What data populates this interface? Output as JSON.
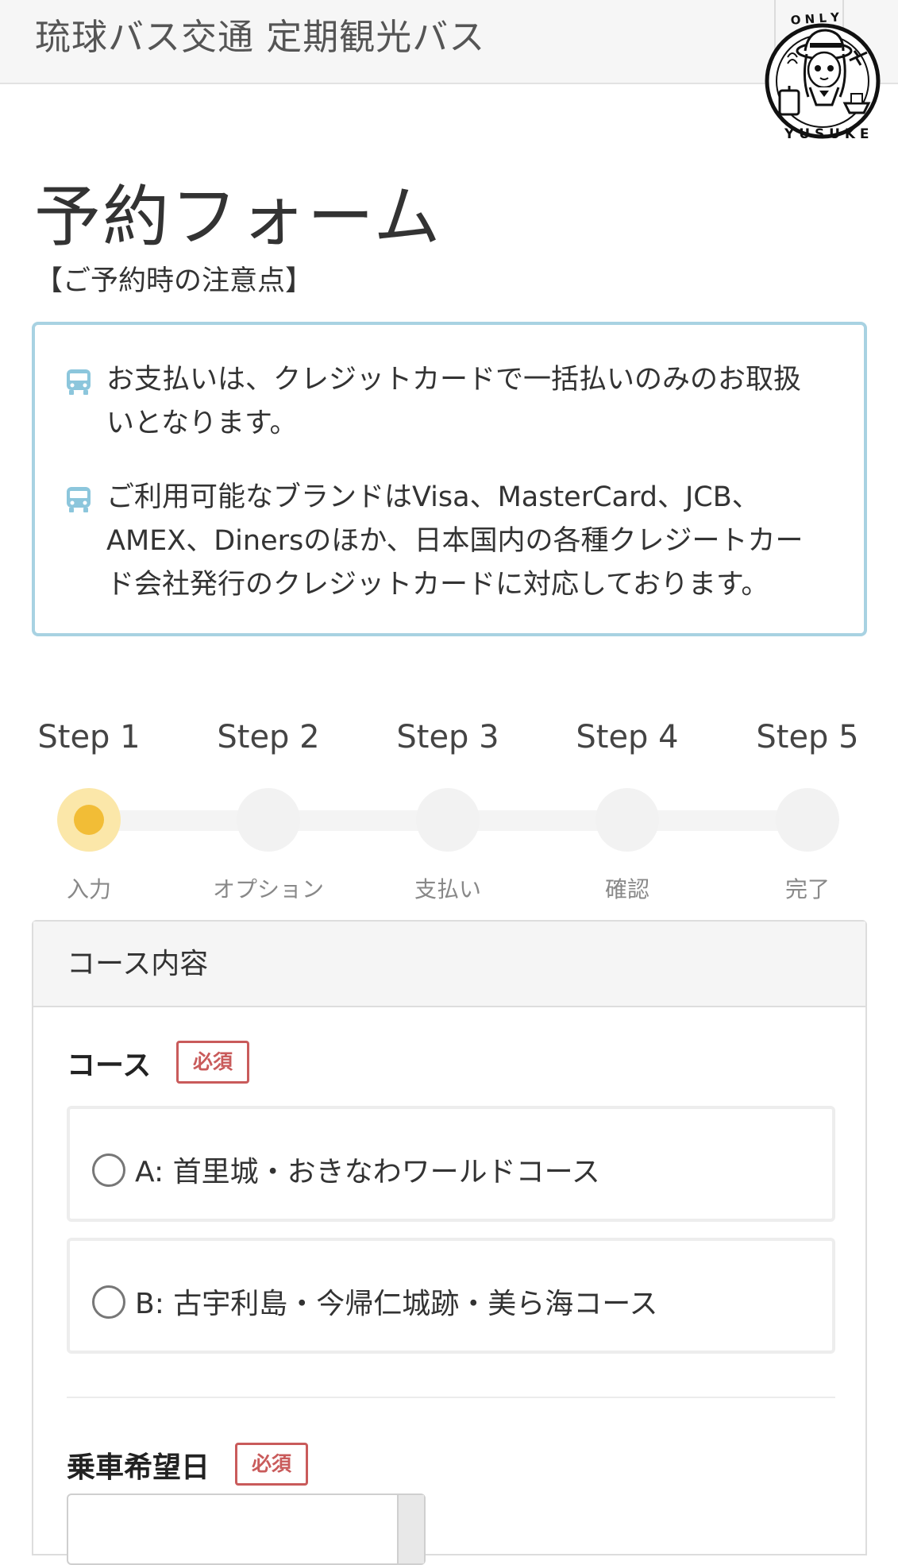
{
  "header": {
    "title": "琉球バス交通 定期観光バス",
    "stamp_text_top": "ONLY",
    "stamp_text_bottom": "YUSUKE"
  },
  "page_title": "予約フォーム",
  "notice": {
    "heading": "【ご予約時の注意点】",
    "items": [
      {
        "text": "お支払いは、クレジットカードで一括払いのみのお取扱いとなります。"
      },
      {
        "text": "ご利用可能なブランドはVisa、MasterCard、JCB、AMEX、Dinersのほか、日本国内の各種クレジートカード会社発行のクレジットカードに対応しております。"
      }
    ],
    "icon": "bus-icon",
    "accent_color": "#a8d2e2"
  },
  "steps": [
    {
      "label": "Step 1",
      "sub": "入力",
      "active": true
    },
    {
      "label": "Step 2",
      "sub": "オプション",
      "active": false
    },
    {
      "label": "Step 3",
      "sub": "支払い",
      "active": false
    },
    {
      "label": "Step 4",
      "sub": "確認",
      "active": false
    },
    {
      "label": "Step 5",
      "sub": "完了",
      "active": false
    }
  ],
  "form": {
    "section_title": "コース内容",
    "course": {
      "label": "コース",
      "required": "必須",
      "options": [
        {
          "label": "A: 首里城・おきなわワールドコース"
        },
        {
          "label": "B: 古宇利島・今帰仁城跡・美ら海コース"
        }
      ]
    },
    "date": {
      "label": "乗車希望日",
      "required": "必須",
      "value": ""
    }
  },
  "colors": {
    "required": "#c95b5b",
    "step_active": "#f2bd36"
  }
}
